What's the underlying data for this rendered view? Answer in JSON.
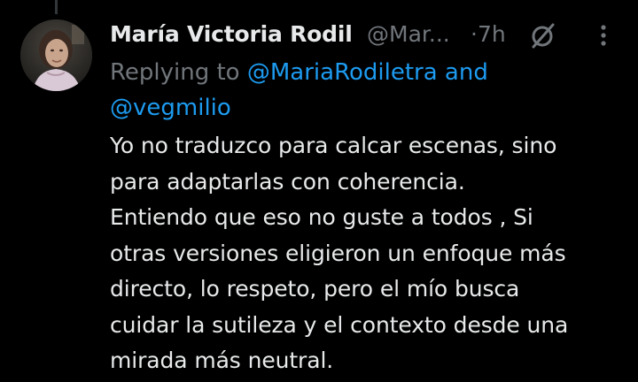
{
  "post": {
    "author_name": "María Victoria Rodil",
    "handle": "@Mar...",
    "separator": "·",
    "time": "7h",
    "reply": {
      "prefix": "Replying to",
      "mention_1": "@MariaRodiletra",
      "conjunction": "and",
      "mention_2": "@vegmilio"
    },
    "text": "Yo no traduzco para calcar escenas, sino\npara adaptarlas con coherencia.\nEntiendo que eso no guste a todos , Si\notras versiones eligieron un enfoque más\ndirecto, lo respeto, pero el mío busca\ncuidar la sutileza y el contexto desde una\nmirada más neutral."
  },
  "icons": {
    "grok": "grok-icon",
    "more": "more-options-icon"
  },
  "colors": {
    "background": "#000000",
    "text_primary": "#e7e9ea",
    "text_secondary": "#71767b",
    "link": "#1d9bf0"
  }
}
